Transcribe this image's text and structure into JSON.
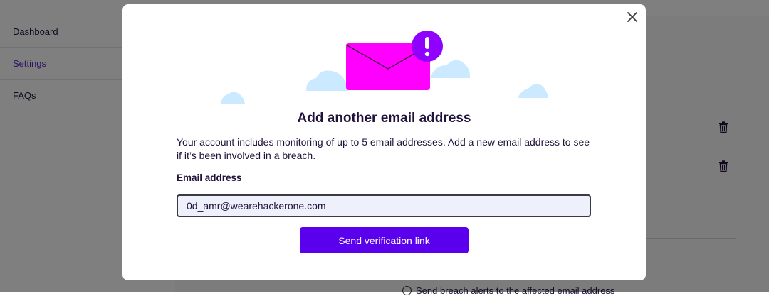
{
  "sidebar": {
    "items": [
      {
        "label": "Dashboard",
        "active": false
      },
      {
        "label": "Settings",
        "active": true
      },
      {
        "label": "FAQs",
        "active": false
      }
    ]
  },
  "main": {
    "radio_option_label": "Send breach alerts to the affected email address"
  },
  "modal": {
    "title": "Add another email address",
    "description": "Your account includes monitoring of up to 5 email addresses. Add a new email address to see if it’s been involved in a breach.",
    "field_label": "Email address",
    "email_value": "0d_amr@wearehackerone.com",
    "submit_label": "Send verification link",
    "close_icon": "close-icon",
    "illustration_icon": "envelope-alert-icon"
  },
  "colors": {
    "accent": "#592acb",
    "button": "#5b00ec",
    "envelope": "#ff00ff",
    "badge": "#8f00ff",
    "cloud": "#cbe9ff"
  }
}
